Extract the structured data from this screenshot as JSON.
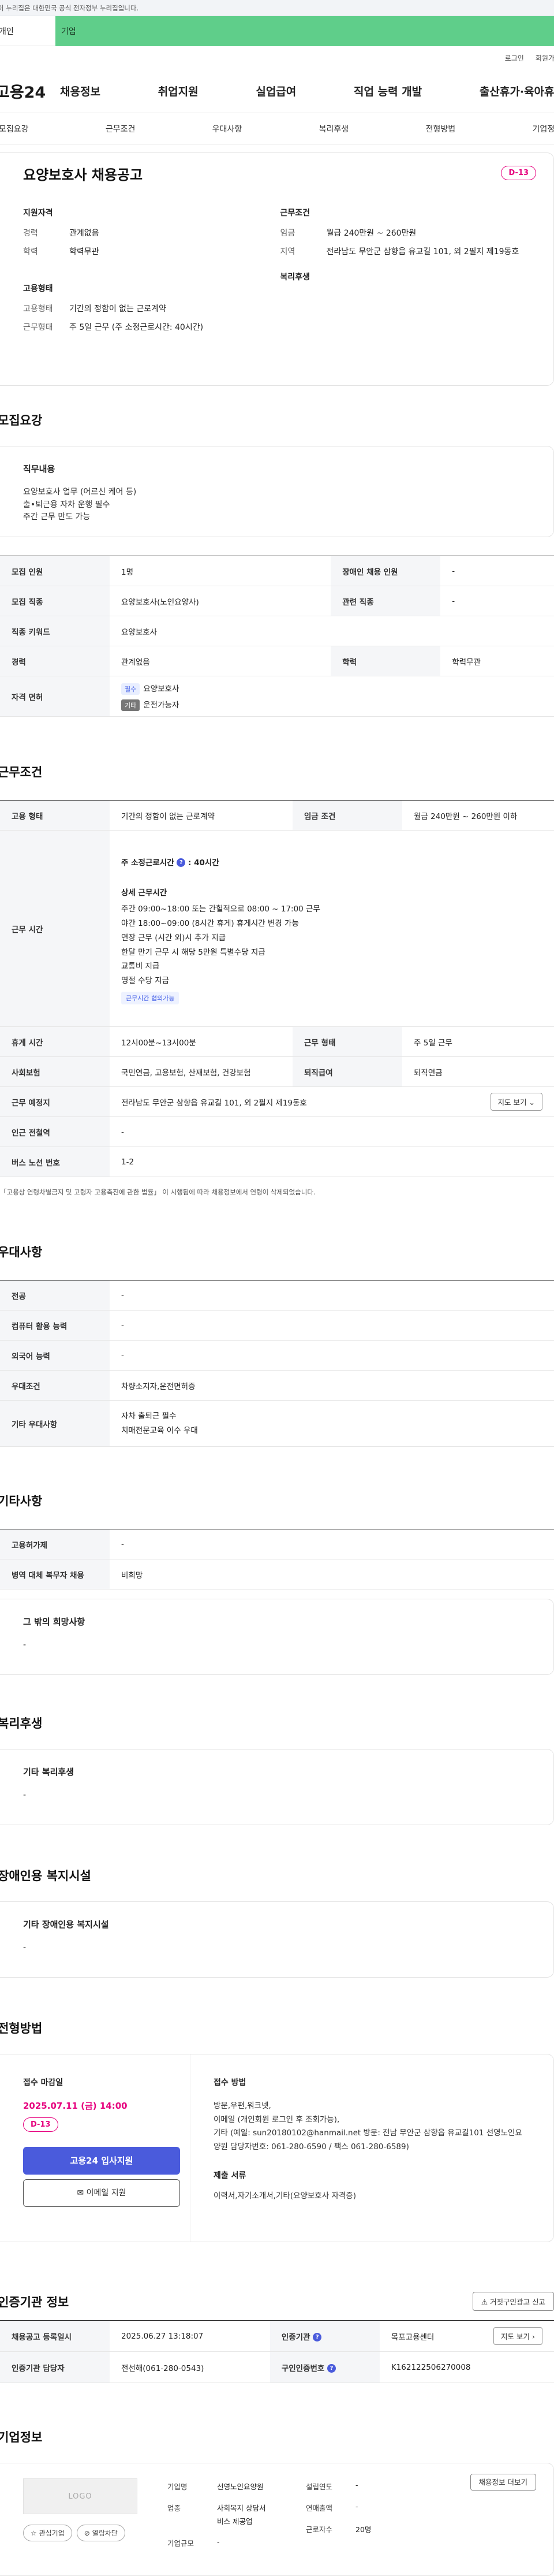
{
  "gov_bar": {
    "text": "이 누리집은 대한민국 공식 전자정부 누리집입니다."
  },
  "member_tabs": {
    "personal": "개인",
    "corporate": "기업"
  },
  "util": {
    "login": "로그인",
    "signup": "회원가입"
  },
  "site": {
    "logo": "고용24"
  },
  "gnb": [
    "채용정보",
    "취업지원",
    "실업급여",
    "직업 능력 개발",
    "출산휴가·육아휴직"
  ],
  "subnav": [
    "모집요강",
    "근무조건",
    "우대사항",
    "복리후생",
    "전형방법",
    "기업정보"
  ],
  "hero": {
    "title": "요양보호사 채용공고",
    "dday": "D-13",
    "qual_title": "지원자격",
    "career_k": "경력",
    "career_v": "관계없음",
    "edu_k": "학력",
    "edu_v": "학력무관",
    "work_title": "근무조건",
    "wage_k": "임금",
    "wage_v": "월급 240만원 ~ 260만원",
    "region_k": "지역",
    "region_v": "전라남도 무안군 삼향읍 유교길 101, 외 2필지 제19동호",
    "emp_title": "고용형태",
    "emptype_k": "고용형태",
    "emptype_v": "기간의 정함이 없는 근로계약",
    "worktype_k": "근무형태",
    "worktype_v": "주 5일 근무 (주 소정근로시간: 40시간)",
    "welfare_title": "복리후생"
  },
  "recruit": {
    "title": "모집요강",
    "duty_title": "직무내용",
    "duty_lines": [
      "요양보호사 업무 (어르신 케어 등)",
      "출•퇴근용 자차 운행 필수",
      "주간 근무 만도 가능"
    ],
    "rows": {
      "count_k": "모집 인원",
      "count_v": "1명",
      "disabled_k": "장애인 채용 인원",
      "disabled_v": "-",
      "job_k": "모집 직종",
      "job_v": "요양보호사(노인요양사)",
      "related_k": "관련 직종",
      "related_v": "-",
      "keyword_k": "직종 키워드",
      "keyword_v": "요양보호사",
      "career_k": "경력",
      "career_v": "관계없음",
      "edu_k": "학력",
      "edu_v": "학력무관",
      "license_k": "자격 면허",
      "license_1_badge": "필수",
      "license_1": "요양보호사",
      "license_2_badge": "기타",
      "license_2": "운전가능자"
    }
  },
  "condition": {
    "title": "근무조건",
    "emptype_k": "고용 형태",
    "emptype_v": "기간의 정함이 없는 근로계약",
    "wage_k": "임금 조건",
    "wage_v": "월급 240만원 ~ 260만원 이하",
    "hours_k": "근무 시간",
    "hours_weekly": "주 소정근로시간",
    "hours_weekly_v": ": 40시간",
    "hours_detail_title": "상세 근무시간",
    "hours_lines": [
      "주간 09:00~18:00 또는 간헐적으로 08:00 ~ 17:00 근무",
      "야간 18:00~09:00 (8시간 휴게) 휴게시간 변경 가능",
      "연장 근무 (시간 외)시 추가 지급",
      "한달 만기 근무 시 해당 5만원 특별수당 지급",
      "교통비 지급",
      "명절 수당 지급"
    ],
    "hours_link": "근무시간 협의가능",
    "break_k": "휴게 시간",
    "break_v": "12시00분~13시00분",
    "workform_k": "근무 형태",
    "workform_v": "주 5일 근무",
    "insurance_k": "사회보험",
    "insurance_v": "국민연금, 고용보험, 산재보험, 건강보험",
    "severance_k": "퇴직급여",
    "severance_v": "퇴직연금",
    "place_k": "근무 예정지",
    "place_v": "전라남도 무안군 삼향읍 유교길 101, 외 2필지 제19동호",
    "map_btn": "지도 보기",
    "station_k": "인근 전철역",
    "station_v": "-",
    "bus_k": "버스 노선 번호",
    "bus_v": "1-2",
    "note": "「고용상 연령차별금지 및 고령자 고용촉진에 관한 법률」 이 시행됨에 따라 채용정보에서 연령이 삭제되었습니다."
  },
  "preference": {
    "title": "우대사항",
    "major_k": "전공",
    "major_v": "-",
    "computer_k": "컴퓨터 활용 능력",
    "computer_v": "-",
    "language_k": "외국어 능력",
    "language_v": "-",
    "cond_k": "우대조건",
    "cond_v": "차량소지자,운전면허증",
    "etc_k": "기타 우대사항",
    "etc_lines": [
      "자차 출퇴근 필수",
      "치매전문교육 이수 우대"
    ]
  },
  "other": {
    "title": "기타사항",
    "period_k": "고용허가제",
    "period_v": "-",
    "military_k": "병역 대체 복무자 채용",
    "military_v": "비희망",
    "extra_title": "그 밖의 희망사항",
    "extra_v": "-"
  },
  "welfare": {
    "title": "복리후생",
    "box_title": "기타 복리후생",
    "box_v": "-"
  },
  "disabled": {
    "title": "장애인용 복지시설",
    "box_title": "기타 장애인용 복지시설",
    "box_v": "-"
  },
  "selection": {
    "title": "전형방법",
    "deadline_title": "접수 마감일",
    "deadline": "2025.07.11 (금) 14:00",
    "dday": "D-13",
    "apply_btn": "고용24 입사지원",
    "email_btn": "이메일 지원",
    "method_title": "접수 방법",
    "method_lines": [
      "방문,우편,워크넷,",
      "이메일 (개인회원 로그인 후 조회가능),",
      "기타 (예일: sun20180102@hanmail.net  방문: 전남 무안군 삼향읍 유교길101 선영노인요",
      "양원 담당자번호: 061-280-6590 / 팩스 061-280-6589)"
    ],
    "docs_title": "제출 서류",
    "docs_v": "이력서,자기소개서,기타(요양보호사 자격증)"
  },
  "agency": {
    "title": "인증기관 정보",
    "report_btn": "거짓구인광고 신고",
    "reg_k": "채용공고 등록일시",
    "reg_v": "2025.06.27 13:18:07",
    "org_k": "인증기관",
    "org_v": "목포고용센터",
    "map_btn": "지도 보기",
    "manager_k": "인증기관 담당자",
    "manager_v": "전선해(061-280-0543)",
    "reqno_k": "구인인증번호",
    "reqno_v": "K162122506270008"
  },
  "company": {
    "title": "기업정보",
    "logo": "LOGO",
    "fav_btn": "관심기업",
    "block_btn": "열람차단",
    "name_k": "기업명",
    "name_v": "선영노인요양원",
    "founded_k": "설립연도",
    "founded_v": "-",
    "biz_btn": "채용정보 더보기",
    "industry_k": "업종",
    "industry_lines": [
      "사회복지 상담서",
      "비스 제공업"
    ],
    "sales_k": "연매출액",
    "sales_v": "-",
    "employees_k": "근로자수",
    "employees_v": "20명",
    "size_k": "기업규모",
    "size_v": "-"
  }
}
